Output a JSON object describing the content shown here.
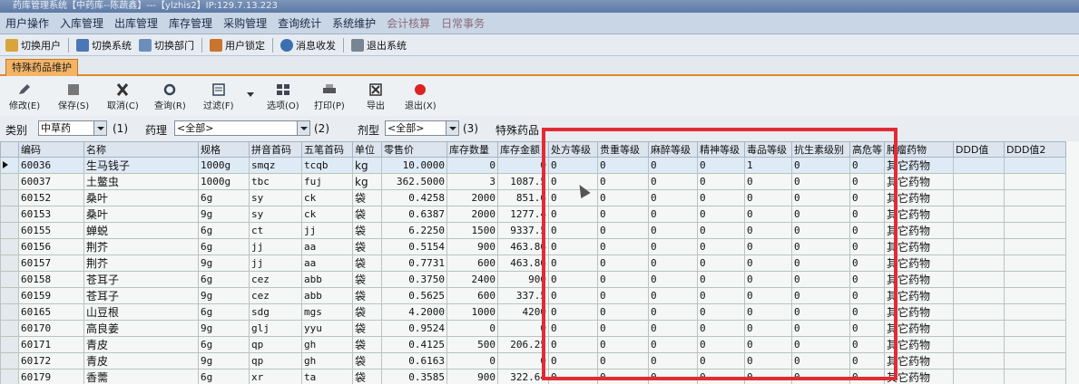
{
  "title_bar": "药库管理系统【中药库--陈蔬鑫】---【ylzhis2】IP:129.7.13.223",
  "menu": [
    "用户操作",
    "入库管理",
    "出库管理",
    "库存管理",
    "采购管理",
    "查询统计",
    "系统维护",
    "会计核算",
    "日常事务"
  ],
  "quickbar": [
    "切换用户",
    "切换系统",
    "切换部门",
    "用户锁定",
    "消息收发",
    "退出系统"
  ],
  "tab_label": "特殊药品维护",
  "toolbar": {
    "edit": "修改(E)",
    "save": "保存(S)",
    "cancel": "取消(C)",
    "query": "查询(R)",
    "filter": "过滤(F)",
    "options": "选项(O)",
    "print": "打印(P)",
    "export": "导出",
    "exit": "退出(X)"
  },
  "filters": {
    "category_label": "类别",
    "category_value": "中草药",
    "hint1": "(1)",
    "pharm_label": "药理",
    "pharm_value": "<全部>",
    "hint2": "(2)",
    "form_label": "剂型",
    "form_value": "<全部>",
    "hint3": "(3)",
    "special_label": "特殊药品"
  },
  "columns": [
    "编码",
    "名称",
    "规格",
    "拼音首码",
    "五笔首码",
    "单位",
    "零售价",
    "库存数量",
    "库存金额",
    "处方等级",
    "贵重等级",
    "麻醉等级",
    "精神等级",
    "毒品等级",
    "抗生素级别",
    "高危等",
    "肿瘤药物",
    "DDD值",
    "DDD值2"
  ],
  "rows": [
    [
      "60036",
      "生马钱子",
      "1000g",
      "smqz",
      "tcqb",
      "kg",
      "10.0000",
      "0",
      "0",
      "0",
      "0",
      "0",
      "0",
      "1",
      "0",
      "0",
      "其它药物",
      "",
      ""
    ],
    [
      "60037",
      "土鳖虫",
      "1000g",
      "tbc",
      "fuj",
      "kg",
      "362.5000",
      "3",
      "1087.5",
      "0",
      "0",
      "0",
      "0",
      "0",
      "0",
      "0",
      "其它药物",
      "",
      ""
    ],
    [
      "60152",
      "桑叶",
      "6g",
      "sy",
      "ck",
      "袋",
      "0.4258",
      "2000",
      "851.6",
      "0",
      "0",
      "0",
      "0",
      "0",
      "0",
      "0",
      "其它药物",
      "",
      ""
    ],
    [
      "60153",
      "桑叶",
      "9g",
      "sy",
      "ck",
      "袋",
      "0.6387",
      "2000",
      "1277.4",
      "0",
      "0",
      "0",
      "0",
      "0",
      "0",
      "0",
      "其它药物",
      "",
      ""
    ],
    [
      "60155",
      "蝉蜕",
      "6g",
      "ct",
      "jj",
      "袋",
      "6.2250",
      "1500",
      "9337.5",
      "0",
      "0",
      "0",
      "0",
      "0",
      "0",
      "0",
      "其它药物",
      "",
      ""
    ],
    [
      "60156",
      "荆芥",
      "6g",
      "jj",
      "aa",
      "袋",
      "0.5154",
      "900",
      "463.86",
      "0",
      "0",
      "0",
      "0",
      "0",
      "0",
      "0",
      "其它药物",
      "",
      ""
    ],
    [
      "60157",
      "荆芥",
      "9g",
      "jj",
      "aa",
      "袋",
      "0.7731",
      "600",
      "463.86",
      "0",
      "0",
      "0",
      "0",
      "0",
      "0",
      "0",
      "其它药物",
      "",
      ""
    ],
    [
      "60158",
      "苍耳子",
      "6g",
      "cez",
      "abb",
      "袋",
      "0.3750",
      "2400",
      "900",
      "0",
      "0",
      "0",
      "0",
      "0",
      "0",
      "0",
      "其它药物",
      "",
      ""
    ],
    [
      "60159",
      "苍耳子",
      "9g",
      "cez",
      "abb",
      "袋",
      "0.5625",
      "600",
      "337.5",
      "0",
      "0",
      "0",
      "0",
      "0",
      "0",
      "0",
      "其它药物",
      "",
      ""
    ],
    [
      "60165",
      "山豆根",
      "6g",
      "sdg",
      "mgs",
      "袋",
      "4.2000",
      "1000",
      "4200",
      "0",
      "0",
      "0",
      "0",
      "0",
      "0",
      "0",
      "其它药物",
      "",
      ""
    ],
    [
      "60170",
      "高良姜",
      "9g",
      "glj",
      "yyu",
      "袋",
      "0.9524",
      "0",
      "0",
      "0",
      "0",
      "0",
      "0",
      "0",
      "0",
      "0",
      "其它药物",
      "",
      ""
    ],
    [
      "60171",
      "青皮",
      "6g",
      "qp",
      "gh",
      "袋",
      "0.4125",
      "500",
      "206.25",
      "0",
      "0",
      "0",
      "0",
      "0",
      "0",
      "0",
      "其它药物",
      "",
      ""
    ],
    [
      "60172",
      "青皮",
      "9g",
      "qp",
      "gh",
      "袋",
      "0.6163",
      "0",
      "0",
      "0",
      "0",
      "0",
      "0",
      "0",
      "0",
      "0",
      "其它药物",
      "",
      ""
    ],
    [
      "60179",
      "香薷",
      "6g",
      "xr",
      "ta",
      "袋",
      "0.3585",
      "900",
      "322.64",
      "0",
      "0",
      "0",
      "0",
      "0",
      "0",
      "0",
      "其它药物",
      "",
      ""
    ]
  ]
}
